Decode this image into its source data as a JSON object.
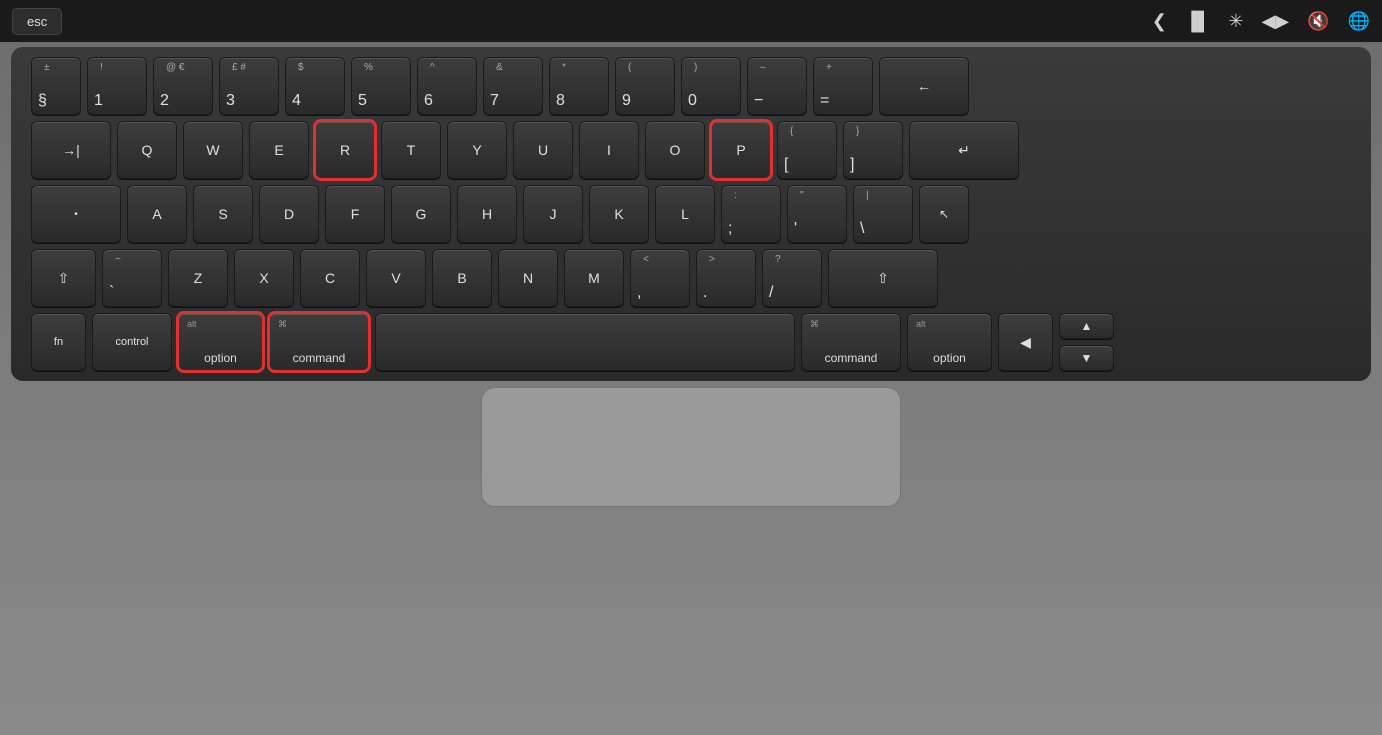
{
  "keyboard": {
    "touchbar": {
      "esc_label": "esc",
      "icons": [
        "‹",
        "▐▌",
        "✶",
        "◀▶",
        "🔇",
        "🌐"
      ]
    },
    "highlighted_keys": [
      "R",
      "P",
      "option-left",
      "command-left"
    ],
    "rows": {
      "row_num": [
        {
          "top": "±",
          "bottom": "§",
          "size": "w50"
        },
        {
          "top": "!",
          "bottom": "1",
          "size": "w60"
        },
        {
          "top": "@€",
          "bottom": "2",
          "size": "w60"
        },
        {
          "top": "£ #",
          "bottom": "3",
          "size": "w60"
        },
        {
          "top": "$",
          "bottom": "4",
          "size": "w60"
        },
        {
          "top": "%",
          "bottom": "5",
          "size": "w60"
        },
        {
          "top": "^",
          "bottom": "6",
          "size": "w60"
        },
        {
          "top": "&",
          "bottom": "7",
          "size": "w60"
        },
        {
          "top": "*",
          "bottom": "8",
          "size": "w60"
        },
        {
          "top": "(",
          "bottom": "9",
          "size": "w60"
        },
        {
          "top": ")",
          "bottom": "0",
          "size": "w60"
        },
        {
          "top": "–",
          "bottom": "−",
          "size": "w60"
        },
        {
          "top": "+",
          "bottom": "=",
          "size": "w60"
        },
        {
          "top": "",
          "bottom": "←",
          "size": "w90"
        }
      ],
      "row_qwerty": [
        {
          "label": "→|",
          "size": "w80"
        },
        {
          "label": "Q",
          "size": "w60"
        },
        {
          "label": "W",
          "size": "w60"
        },
        {
          "label": "E",
          "size": "w60"
        },
        {
          "label": "R",
          "size": "w60",
          "highlight": true
        },
        {
          "label": "T",
          "size": "w60"
        },
        {
          "label": "Y",
          "size": "w60"
        },
        {
          "label": "U",
          "size": "w60"
        },
        {
          "label": "I",
          "size": "w60"
        },
        {
          "label": "O",
          "size": "w60"
        },
        {
          "label": "P",
          "size": "w60",
          "highlight": true
        },
        {
          "top": "{",
          "bottom": "[",
          "size": "w60"
        },
        {
          "top": "}",
          "bottom": "]",
          "size": "w60"
        },
        {
          "label": "↵",
          "size": "w110"
        }
      ],
      "row_asdf": [
        {
          "label": "•",
          "size": "w90"
        },
        {
          "label": "A",
          "size": "w60"
        },
        {
          "label": "S",
          "size": "w60"
        },
        {
          "label": "D",
          "size": "w60"
        },
        {
          "label": "F",
          "size": "w60"
        },
        {
          "label": "G",
          "size": "w60"
        },
        {
          "label": "H",
          "size": "w60"
        },
        {
          "label": "J",
          "size": "w60"
        },
        {
          "label": "K",
          "size": "w60"
        },
        {
          "label": "L",
          "size": "w60"
        },
        {
          "top": ":",
          "bottom": ";",
          "size": "w60"
        },
        {
          "top": "\"",
          "bottom": "'",
          "size": "w60"
        },
        {
          "top": "|",
          "bottom": "\\",
          "size": "w60"
        },
        {
          "label": "↖",
          "size": "w50"
        }
      ],
      "row_zxcv": [
        {
          "label": "⇧",
          "size": "w65"
        },
        {
          "top": "~",
          "bottom": "`",
          "size": "w60"
        },
        {
          "label": "Z",
          "size": "w60"
        },
        {
          "label": "X",
          "size": "w60"
        },
        {
          "label": "C",
          "size": "w60"
        },
        {
          "label": "V",
          "size": "w60"
        },
        {
          "label": "B",
          "size": "w60"
        },
        {
          "label": "N",
          "size": "w60"
        },
        {
          "label": "M",
          "size": "w60"
        },
        {
          "top": "<",
          "bottom": ",",
          "size": "w60"
        },
        {
          "top": ">",
          "bottom": ".",
          "size": "w60"
        },
        {
          "top": "?",
          "bottom": "/",
          "size": "w60"
        },
        {
          "label": "⇧",
          "size": "w110"
        }
      ],
      "row_bottom": [
        {
          "label": "fn",
          "size": "w55"
        },
        {
          "label": "control",
          "size": "w80"
        },
        {
          "top": "alt",
          "bottom": "option",
          "size": "w85",
          "highlight": true
        },
        {
          "top": "⌘",
          "bottom": "command",
          "size": "w100",
          "highlight": true
        },
        {
          "label": "",
          "size": "w420"
        },
        {
          "top": "⌘",
          "bottom": "command",
          "size": "w100"
        },
        {
          "top": "alt",
          "bottom": "option",
          "size": "w85"
        },
        {
          "label": "◀",
          "size": "w55"
        },
        {
          "arrow_up": "▲",
          "arrow_down": "▼",
          "size": "w55"
        }
      ]
    }
  }
}
